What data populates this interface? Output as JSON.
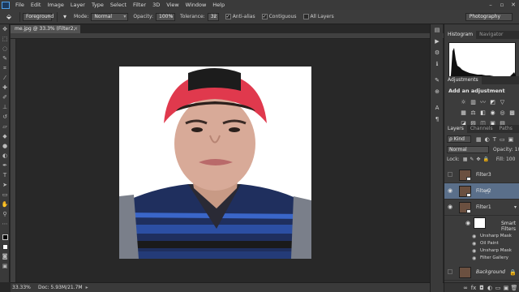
{
  "menubar": {
    "items": [
      "File",
      "Edit",
      "Image",
      "Layer",
      "Type",
      "Select",
      "Filter",
      "3D",
      "View",
      "Window",
      "Help"
    ],
    "window_controls": [
      "–",
      "▫",
      "✕"
    ]
  },
  "options": {
    "tool_icon": "paint-bucket-icon",
    "fill_source": "Foreground",
    "mode_label": "Mode:",
    "mode_value": "Normal",
    "opacity_label": "Opacity:",
    "opacity_value": "100%",
    "tolerance_label": "Tolerance:",
    "tolerance_value": "32",
    "antialias_label": "Anti-alias",
    "contiguous_label": "Contiguous",
    "all_layers_label": "All Layers",
    "workspace": "Photography"
  },
  "document": {
    "tab_title": "me.jpg @ 33.3% (Filter2, RGB/8) *",
    "image_alt": "Photo: young man wearing red cap and striped shirt"
  },
  "status": {
    "zoom": "33.33%",
    "doc_info": "Doc: 5.93M/21.7M"
  },
  "histogram": {
    "tabs": [
      "Histogram",
      "Navigator"
    ]
  },
  "adjustments": {
    "tab": "Adjustments",
    "title": "Add an adjustment"
  },
  "layers": {
    "tabs": [
      "Layers",
      "Channels",
      "Paths"
    ],
    "kind_filter": "ρ Kind",
    "blend_mode": "Normal",
    "opacity_label": "Opacity:",
    "opacity_value": "100",
    "lock_label": "Lock:",
    "fill_label": "Fill:",
    "fill_value": "100",
    "list": [
      {
        "name": "Filter3",
        "visible": false,
        "selected": false
      },
      {
        "name": "Filter2",
        "visible": true,
        "selected": true
      },
      {
        "name": "Filter1",
        "visible": true,
        "selected": false
      }
    ],
    "smart_filters_label": "Smart Filters",
    "filters": [
      "Unsharp Mask",
      "Oil Paint",
      "Unsharp Mask",
      "Filter Gallery"
    ],
    "background_name": "Background"
  },
  "colors": {
    "accent_selection": "#5a6f8a",
    "panel_bg": "#3c3c3c",
    "canvas_bg": "#282828"
  }
}
